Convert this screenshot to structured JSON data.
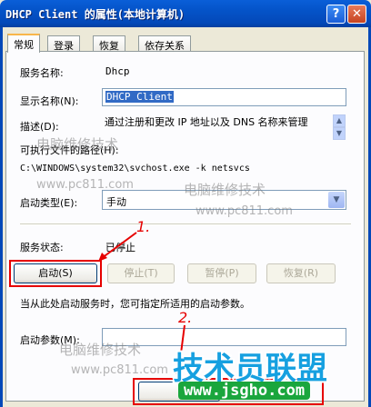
{
  "window": {
    "title": "DHCP Client 的属性(本地计算机)",
    "help_label": "?",
    "close_label": "✕"
  },
  "tabs": [
    {
      "label": "常规",
      "active": true
    },
    {
      "label": "登录",
      "active": false
    },
    {
      "label": "恢复",
      "active": false
    },
    {
      "label": "依存关系",
      "active": false
    }
  ],
  "general": {
    "service_name_label": "服务名称:",
    "service_name_value": "Dhcp",
    "display_name_label": "显示名称(N):",
    "display_name_value": "DHCP Client",
    "description_label": "描述(D):",
    "description_value": "通过注册和更改 IP 地址以及 DNS 名称来管理",
    "exe_path_label": "可执行文件的路径(H):",
    "exe_path_value": "C:\\WINDOWS\\system32\\svchost.exe -k netsvcs",
    "startup_type_label": "启动类型(E):",
    "startup_type_value": "手动",
    "status_label": "服务状态:",
    "status_value": "已停止",
    "buttons": {
      "start": "启动(S)",
      "stop": "停止(T)",
      "pause": "暂停(P)",
      "resume": "恢复(R)"
    },
    "hint_text": "当从此处启动服务时，您可指定所适用的启动参数。",
    "start_params_label": "启动参数(M):",
    "start_params_value": ""
  },
  "annotations": {
    "step1": "1.",
    "step2": "2."
  },
  "watermarks": {
    "cn_text": "电脑维修技术",
    "url_text": "www.pc811.com",
    "logo_text": "技术员联盟",
    "logo_url": "www.jsgho.com"
  },
  "colors": {
    "accent_red": "#e60000",
    "title_blue": "#0348b8",
    "logo_blue": "#16a0e0",
    "logo_green": "#1aa63d"
  }
}
